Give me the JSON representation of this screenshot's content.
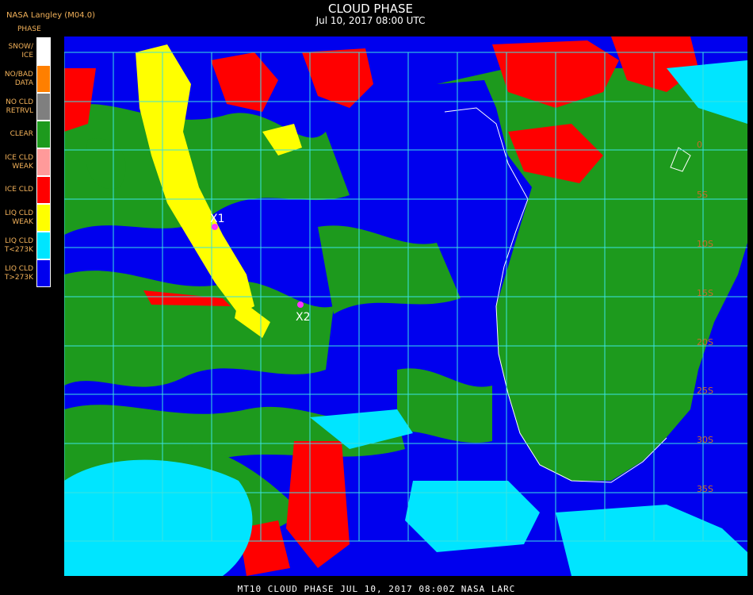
{
  "header": {
    "org": "NASA Langley (M04.0)",
    "phase_label": "PHASE",
    "title": "CLOUD PHASE",
    "subtitle": "Jul 10, 2017 08:00 UTC"
  },
  "legend": [
    {
      "label": "SNOW/\nICE",
      "color": "#ffffff"
    },
    {
      "label": "NO/BAD\nDATA",
      "color": "#ff7f00"
    },
    {
      "label": "NO CLD\nRETRVL",
      "color": "#7f7f7f"
    },
    {
      "label": "CLEAR",
      "color": "#1d9a1d"
    },
    {
      "label": "ICE CLD\nWEAK",
      "color": "#ff9a9a"
    },
    {
      "label": "ICE CLD",
      "color": "#ff0000"
    },
    {
      "label": "LIQ CLD\nWEAK",
      "color": "#ffff00"
    },
    {
      "label": "LIQ CLD\nT<273K",
      "color": "#00e5ff"
    },
    {
      "label": "LIQ CLD\nT>273K",
      "color": "#0000ee"
    }
  ],
  "markers": [
    {
      "label": "X1",
      "color": "#ff33ff"
    },
    {
      "label": "X2",
      "color": "#ff33ff"
    }
  ],
  "lat_labels": [
    "0",
    "5S",
    "10S",
    "15S",
    "20S",
    "25S",
    "30S",
    "35S"
  ],
  "footer": "MT10  CLOUD PHASE   JUL 10, 2017 08:00Z   NASA LARC"
}
